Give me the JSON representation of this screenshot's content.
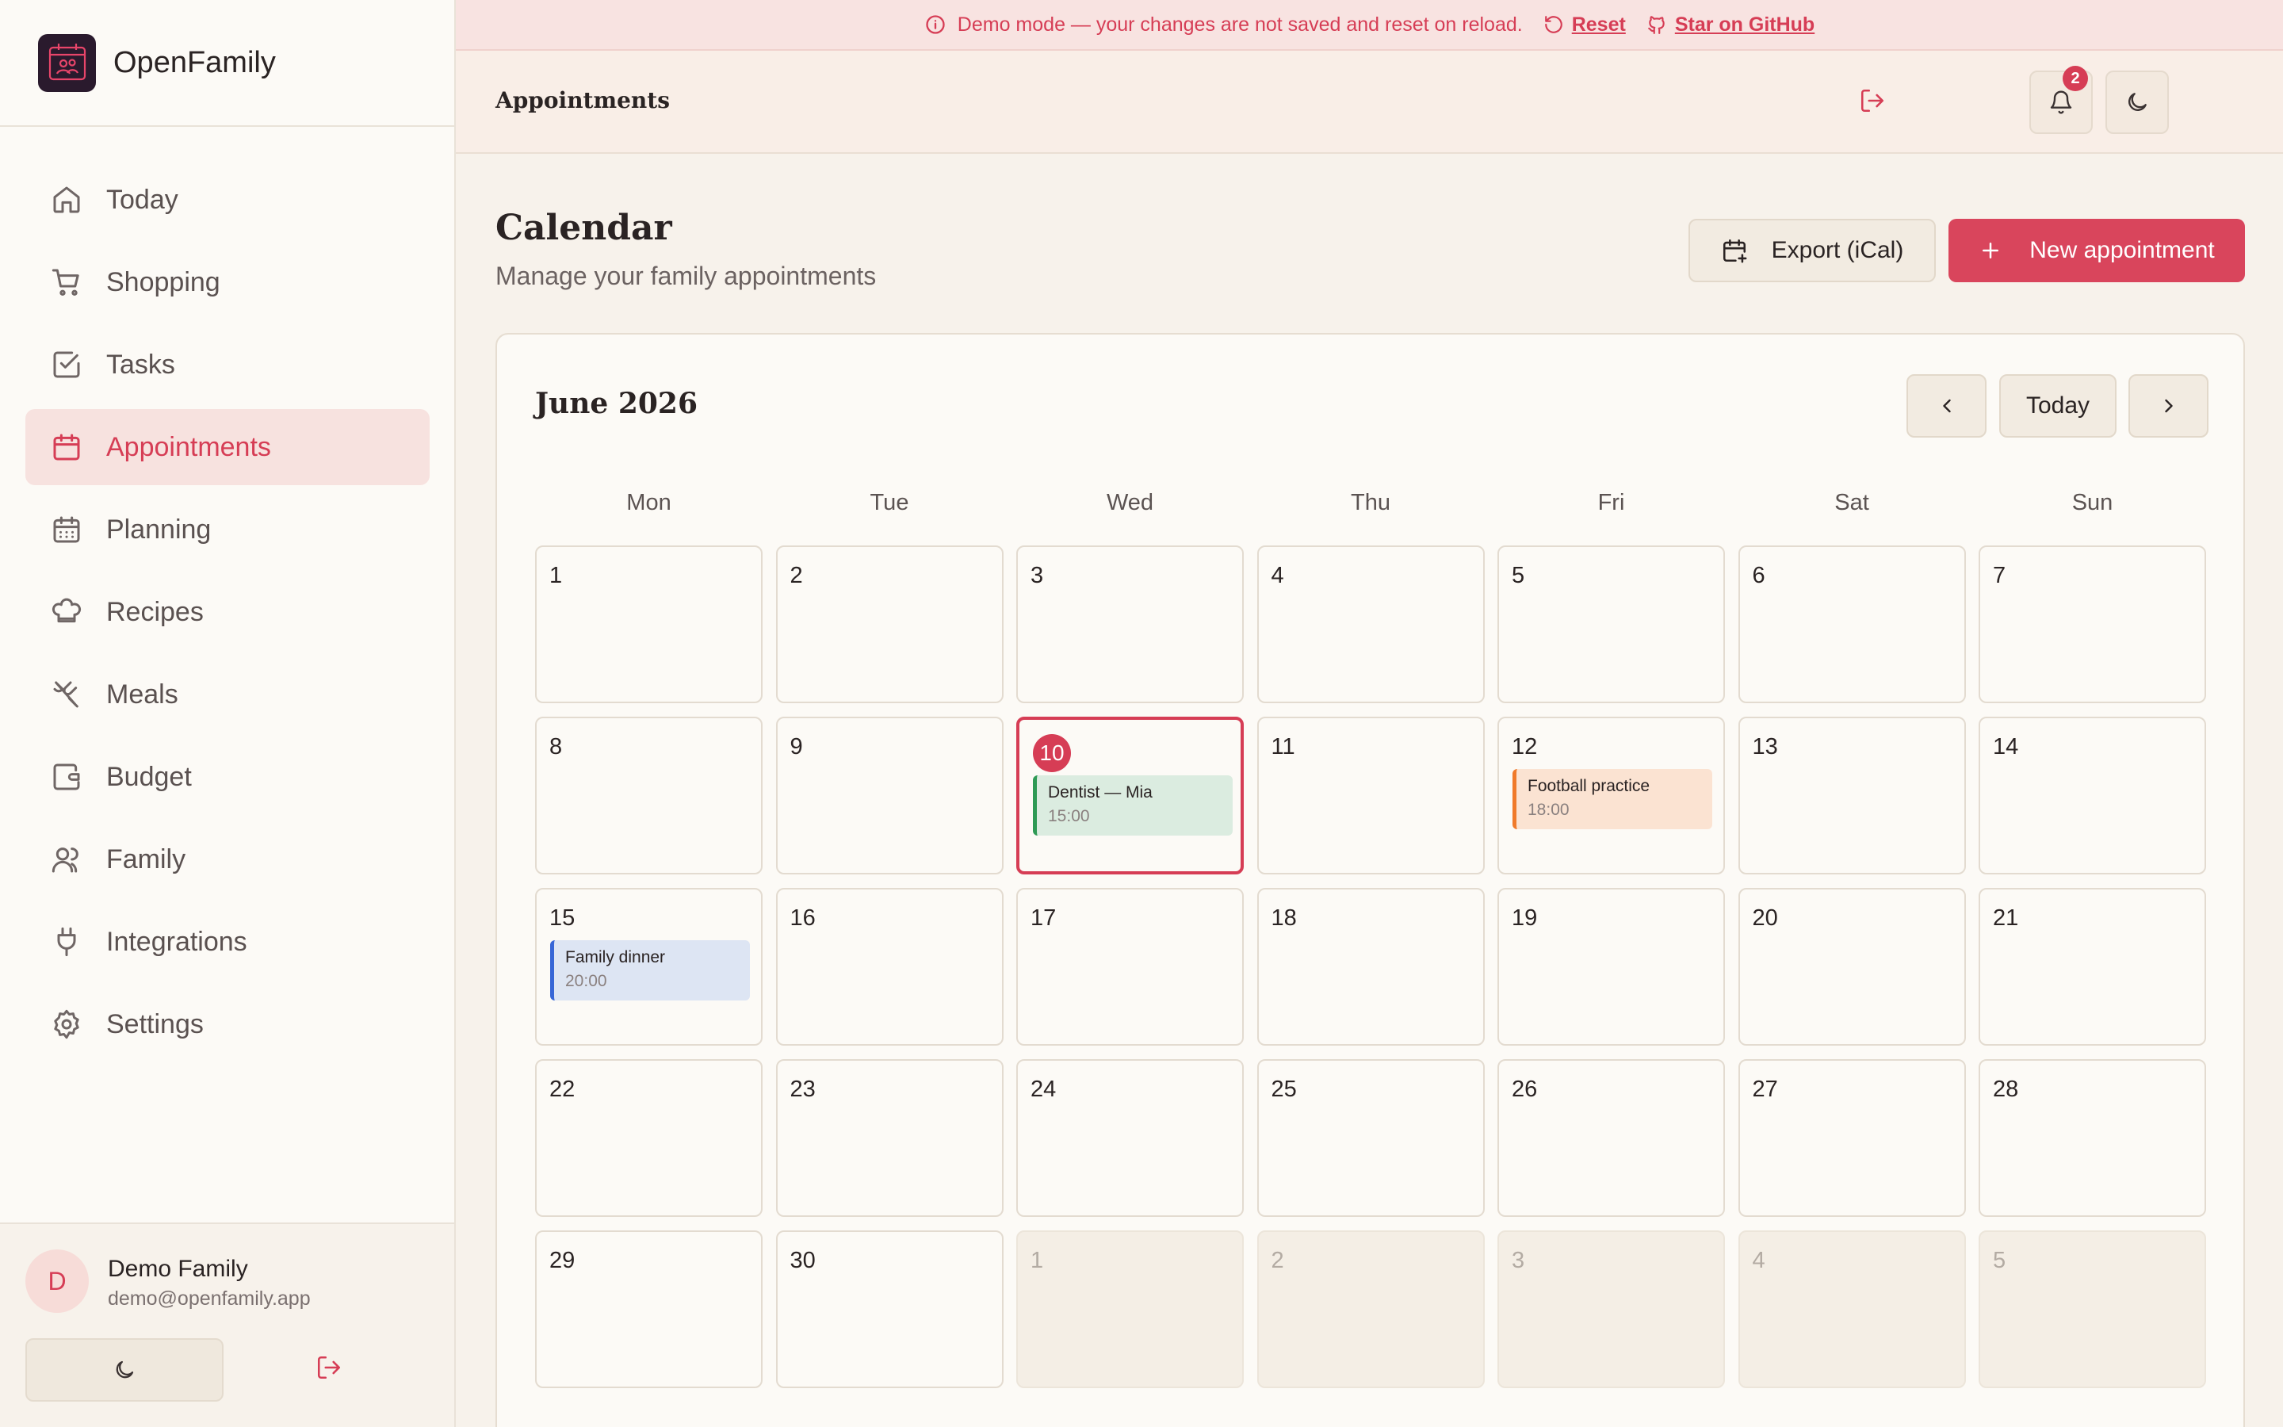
{
  "banner": {
    "message": "Demo mode — your changes are not saved and reset on reload.",
    "reset_label": "Reset",
    "github_label": "Star on GitHub"
  },
  "app": {
    "name": "OpenFamily",
    "logo_text": "OpenFamily"
  },
  "sidebar": {
    "items": [
      {
        "label": "Today",
        "icon": "home-icon"
      },
      {
        "label": "Shopping",
        "icon": "cart-icon"
      },
      {
        "label": "Tasks",
        "icon": "checkbox-icon"
      },
      {
        "label": "Appointments",
        "icon": "calendar-icon",
        "active": true
      },
      {
        "label": "Planning",
        "icon": "calendar-grid-icon"
      },
      {
        "label": "Recipes",
        "icon": "chef-hat-icon"
      },
      {
        "label": "Meals",
        "icon": "utensils-icon"
      },
      {
        "label": "Budget",
        "icon": "wallet-icon"
      },
      {
        "label": "Family",
        "icon": "users-icon"
      },
      {
        "label": "Integrations",
        "icon": "plug-icon"
      },
      {
        "label": "Settings",
        "icon": "gear-icon"
      }
    ]
  },
  "user": {
    "initial": "D",
    "name": "Demo Family",
    "email": "demo@openfamily.app"
  },
  "header": {
    "title": "Appointments",
    "notification_count": "2"
  },
  "page": {
    "title": "Calendar",
    "subtitle": "Manage your family appointments",
    "export_label": "Export (iCal)",
    "new_label": "New appointment"
  },
  "calendar": {
    "month_label": "June 2026",
    "today_label": "Today",
    "weekdays": [
      "Mon",
      "Tue",
      "Wed",
      "Thu",
      "Fri",
      "Sat",
      "Sun"
    ],
    "weeks": [
      [
        {
          "day": "1"
        },
        {
          "day": "2"
        },
        {
          "day": "3"
        },
        {
          "day": "4"
        },
        {
          "day": "5"
        },
        {
          "day": "6"
        },
        {
          "day": "7"
        }
      ],
      [
        {
          "day": "8"
        },
        {
          "day": "9"
        },
        {
          "day": "10",
          "today": true,
          "events": [
            {
              "title": "Dentist — Mia",
              "time": "15:00",
              "color": "green"
            }
          ]
        },
        {
          "day": "11"
        },
        {
          "day": "12",
          "events": [
            {
              "title": "Football practice",
              "time": "18:00",
              "color": "orange"
            }
          ]
        },
        {
          "day": "13"
        },
        {
          "day": "14"
        }
      ],
      [
        {
          "day": "15",
          "events": [
            {
              "title": "Family dinner",
              "time": "20:00",
              "color": "blue"
            }
          ]
        },
        {
          "day": "16"
        },
        {
          "day": "17"
        },
        {
          "day": "18"
        },
        {
          "day": "19"
        },
        {
          "day": "20"
        },
        {
          "day": "21"
        }
      ],
      [
        {
          "day": "22"
        },
        {
          "day": "23"
        },
        {
          "day": "24"
        },
        {
          "day": "25"
        },
        {
          "day": "26"
        },
        {
          "day": "27"
        },
        {
          "day": "28"
        }
      ],
      [
        {
          "day": "29"
        },
        {
          "day": "30"
        },
        {
          "day": "1",
          "other": true
        },
        {
          "day": "2",
          "other": true
        },
        {
          "day": "3",
          "other": true
        },
        {
          "day": "4",
          "other": true
        },
        {
          "day": "5",
          "other": true
        }
      ]
    ]
  },
  "colors": {
    "accent": "#d63d55",
    "event_green": "#2f9a55",
    "event_orange": "#f07a2a",
    "event_blue": "#3766d6"
  }
}
